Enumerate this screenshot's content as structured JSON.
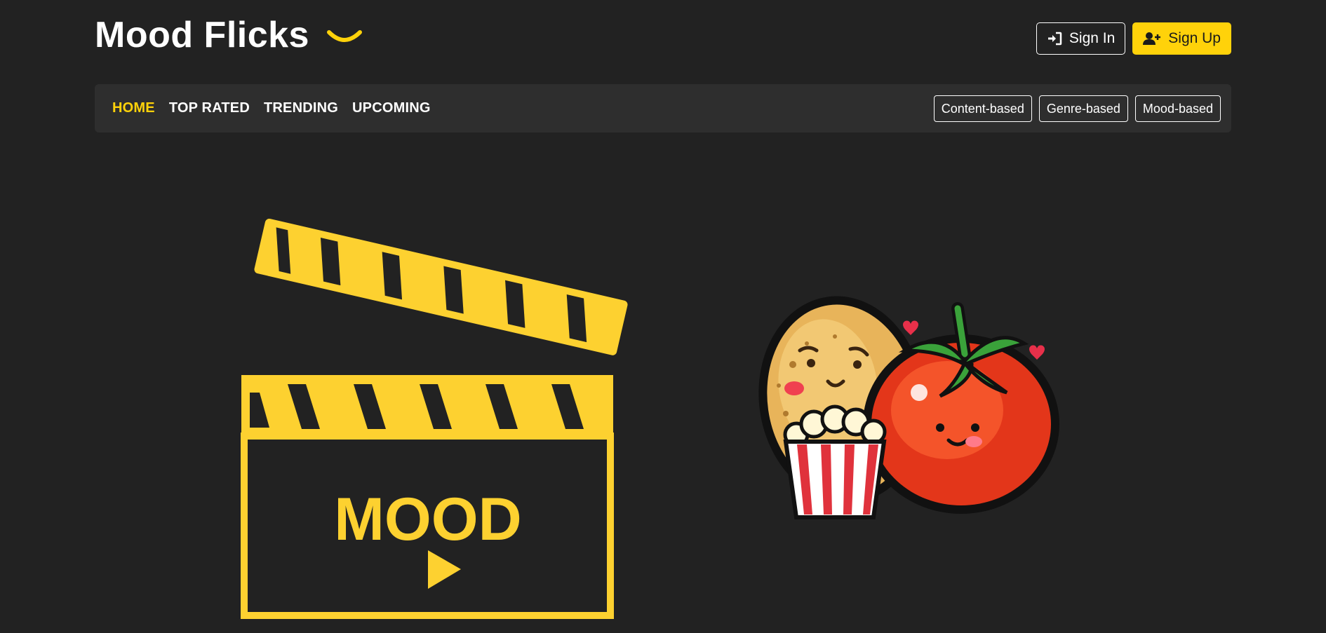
{
  "brand": {
    "title": "Mood Flicks",
    "logo_icon": "smile-icon",
    "accent_color": "#ffd20a"
  },
  "auth": {
    "sign_in_label": "Sign In",
    "sign_in_icon": "sign-in-icon",
    "sign_up_label": "Sign Up",
    "sign_up_icon": "user-plus-icon"
  },
  "nav": {
    "links": [
      {
        "label": "HOME",
        "active": true
      },
      {
        "label": "TOP RATED",
        "active": false
      },
      {
        "label": "TRENDING",
        "active": false
      },
      {
        "label": "UPCOMING",
        "active": false
      }
    ],
    "filters": [
      {
        "label": "Content-based"
      },
      {
        "label": "Genre-based"
      },
      {
        "label": "Mood-based"
      }
    ]
  },
  "hero": {
    "clapper_text": "MOOD",
    "clapper_icon": "play-icon",
    "mascots": "potato-and-tomato-with-popcorn-illustration"
  },
  "colors": {
    "background": "#222222",
    "navbar": "#2e2e2e",
    "accent": "#ffd20a",
    "clapper": "#fdd130"
  }
}
